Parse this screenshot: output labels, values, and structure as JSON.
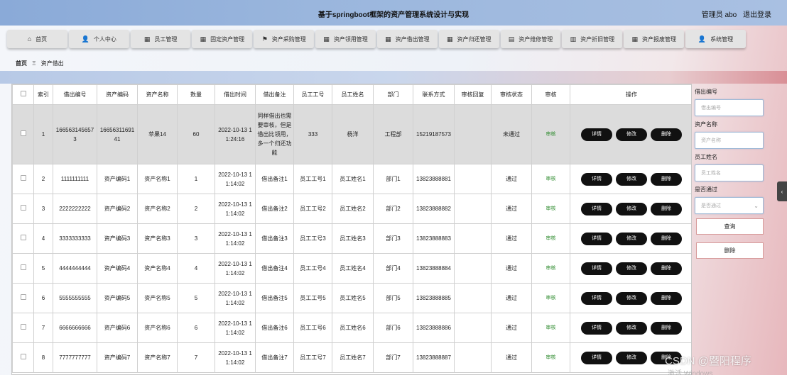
{
  "app": {
    "title": "基于springboot框架的资产管理系统设计与实现",
    "user": "管理员 abo",
    "logout": "退出登录"
  },
  "nav": [
    {
      "label": "首页",
      "icon": "home-icon",
      "glyph": "⌂"
    },
    {
      "label": "个人中心",
      "icon": "user-icon",
      "glyph": "👤"
    },
    {
      "label": "员工管理",
      "icon": "grid-icon",
      "glyph": "▦"
    },
    {
      "label": "固定资产管理",
      "icon": "grid-icon",
      "glyph": "▦"
    },
    {
      "label": "资产采购管理",
      "icon": "flag-icon",
      "glyph": "⚑"
    },
    {
      "label": "资产领用管理",
      "icon": "grid-icon",
      "glyph": "▦"
    },
    {
      "label": "资产借出管理",
      "icon": "grid-icon",
      "glyph": "▦"
    },
    {
      "label": "资产归还管理",
      "icon": "grid-icon",
      "glyph": "▦"
    },
    {
      "label": "资产维修管理",
      "icon": "document-icon",
      "glyph": "▤"
    },
    {
      "label": "资产折旧管理",
      "icon": "bar-chart-icon",
      "glyph": "▥"
    },
    {
      "label": "资产报废管理",
      "icon": "grid-icon",
      "glyph": "▦"
    },
    {
      "label": "系统管理",
      "icon": "user-icon",
      "glyph": "👤"
    }
  ],
  "breadcrumb": {
    "home": "首页",
    "sep": "Ξ",
    "current": "资产借出"
  },
  "table": {
    "columns": [
      "索引",
      "借出编号",
      "资产编码",
      "资产名称",
      "数量",
      "借出时间",
      "借出备注",
      "员工工号",
      "员工姓名",
      "部门",
      "联系方式",
      "审核回复",
      "审核状态",
      "审核",
      "操作"
    ],
    "action_labels": {
      "detail": "详情",
      "edit": "修改",
      "delete": "删除"
    },
    "rows": [
      {
        "index": "1",
        "loan_no": "1665631456573",
        "asset_code": "1665631169141",
        "asset_name": "苹果14",
        "qty": "60",
        "time": "2022-10-13 11:24:16",
        "remark": "同样借出也需要审核，但是借出比领用，多一个归还功能",
        "emp_no": "333",
        "emp_name": "杨洋",
        "dept": "工程部",
        "phone": "15219187573",
        "reply": "",
        "status": "未通过",
        "audit": "审核"
      },
      {
        "index": "2",
        "loan_no": "1111111111",
        "asset_code": "资产编码1",
        "asset_name": "资产名称1",
        "qty": "1",
        "time": "2022-10-13 11:14:02",
        "remark": "借出备注1",
        "emp_no": "员工工号1",
        "emp_name": "员工姓名1",
        "dept": "部门1",
        "phone": "13823888881",
        "reply": "",
        "status": "通过",
        "audit": "审核"
      },
      {
        "index": "3",
        "loan_no": "2222222222",
        "asset_code": "资产编码2",
        "asset_name": "资产名称2",
        "qty": "2",
        "time": "2022-10-13 11:14:02",
        "remark": "借出备注2",
        "emp_no": "员工工号2",
        "emp_name": "员工姓名2",
        "dept": "部门2",
        "phone": "13823888882",
        "reply": "",
        "status": "通过",
        "audit": "审核"
      },
      {
        "index": "4",
        "loan_no": "3333333333",
        "asset_code": "资产编码3",
        "asset_name": "资产名称3",
        "qty": "3",
        "time": "2022-10-13 11:14:02",
        "remark": "借出备注3",
        "emp_no": "员工工号3",
        "emp_name": "员工姓名3",
        "dept": "部门3",
        "phone": "13823888883",
        "reply": "",
        "status": "通过",
        "audit": "审核"
      },
      {
        "index": "5",
        "loan_no": "4444444444",
        "asset_code": "资产编码4",
        "asset_name": "资产名称4",
        "qty": "4",
        "time": "2022-10-13 11:14:02",
        "remark": "借出备注4",
        "emp_no": "员工工号4",
        "emp_name": "员工姓名4",
        "dept": "部门4",
        "phone": "13823888884",
        "reply": "",
        "status": "通过",
        "audit": "审核"
      },
      {
        "index": "6",
        "loan_no": "5555555555",
        "asset_code": "资产编码5",
        "asset_name": "资产名称5",
        "qty": "5",
        "time": "2022-10-13 11:14:02",
        "remark": "借出备注5",
        "emp_no": "员工工号5",
        "emp_name": "员工姓名5",
        "dept": "部门5",
        "phone": "13823888885",
        "reply": "",
        "status": "通过",
        "audit": "审核"
      },
      {
        "index": "7",
        "loan_no": "6666666666",
        "asset_code": "资产编码6",
        "asset_name": "资产名称6",
        "qty": "6",
        "time": "2022-10-13 11:14:02",
        "remark": "借出备注6",
        "emp_no": "员工工号6",
        "emp_name": "员工姓名6",
        "dept": "部门6",
        "phone": "13823888886",
        "reply": "",
        "status": "通过",
        "audit": "审核"
      },
      {
        "index": "8",
        "loan_no": "7777777777",
        "asset_code": "资产编码7",
        "asset_name": "资产名称7",
        "qty": "7",
        "time": "2022-10-13 11:14:02",
        "remark": "借出备注7",
        "emp_no": "员工工号7",
        "emp_name": "员工姓名7",
        "dept": "部门7",
        "phone": "13823888887",
        "reply": "",
        "status": "通过",
        "audit": "审核"
      }
    ]
  },
  "search": {
    "loan_no_label": "借出编号",
    "loan_no_placeholder": "借出编号",
    "asset_name_label": "资产名称",
    "asset_name_placeholder": "资产名称",
    "emp_name_label": "员工姓名",
    "emp_name_placeholder": "员工姓名",
    "pass_label": "是否通过",
    "pass_placeholder": "是否通过",
    "query_button": "查询",
    "delete_button": "删除"
  },
  "watermark": {
    "text": "CSDN @暨阳程序",
    "sub": "激活 Windows"
  }
}
